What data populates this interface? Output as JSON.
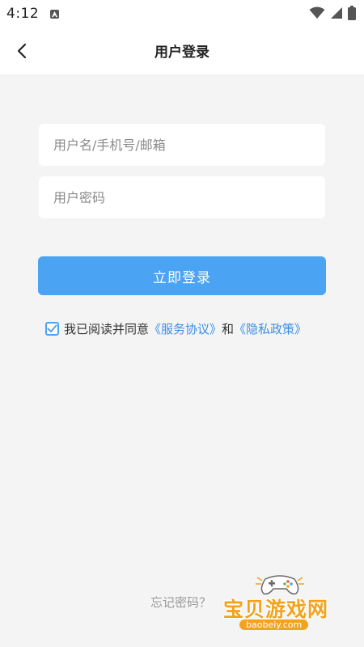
{
  "status_bar": {
    "time": "4:12"
  },
  "header": {
    "title": "用户登录"
  },
  "form": {
    "username_placeholder": "用户名/手机号/邮箱",
    "password_placeholder": "用户密码",
    "login_label": "立即登录"
  },
  "agreement": {
    "checked": true,
    "prefix": "我已阅读并同意",
    "service_link": "《服务协议》",
    "conjunction": "和",
    "privacy_link": "《隐私政策》"
  },
  "footer": {
    "forgot_password": "忘记密码？"
  },
  "watermark": {
    "name": "宝贝游戏网",
    "url": "baobeiy.com"
  },
  "colors": {
    "primary": "#4aa3f3",
    "link": "#3b8fe6",
    "background": "#f4f4f4",
    "watermark": "#f2a31b"
  }
}
